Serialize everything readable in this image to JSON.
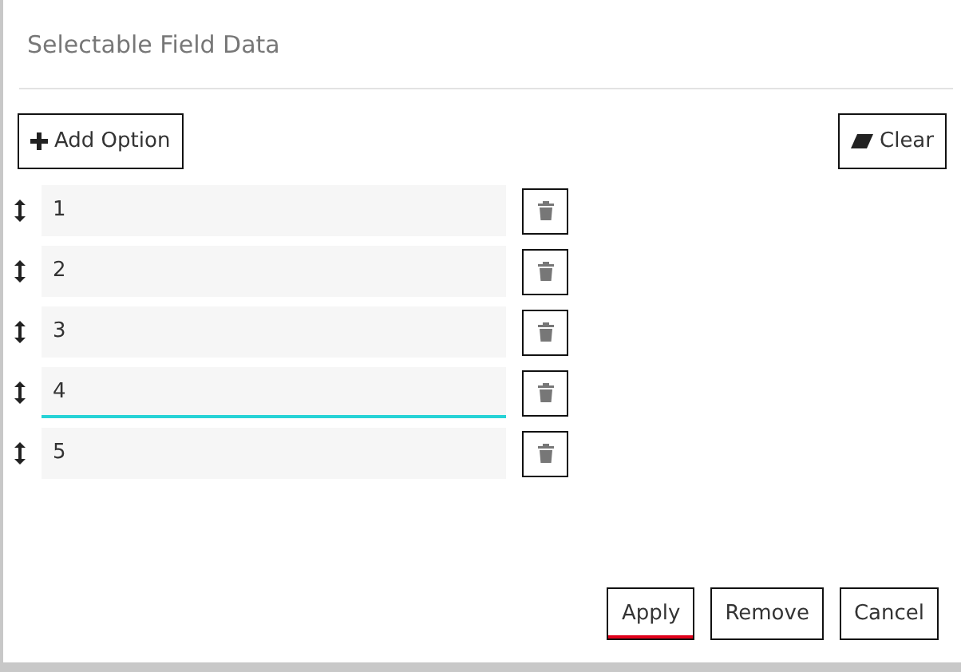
{
  "dialog": {
    "title": "Selectable Field Data"
  },
  "toolbar": {
    "add_button": "Add Option",
    "clear_button": "Clear"
  },
  "options": [
    {
      "value": "1",
      "focused": false
    },
    {
      "value": "2",
      "focused": false
    },
    {
      "value": "3",
      "focused": false
    },
    {
      "value": "4",
      "focused": true
    },
    {
      "value": "5",
      "focused": false
    }
  ],
  "buttons": [
    {
      "label": "Apply",
      "focused": true
    },
    {
      "label": "Remove",
      "focused": false
    },
    {
      "label": "Cancel",
      "focused": false
    }
  ]
}
